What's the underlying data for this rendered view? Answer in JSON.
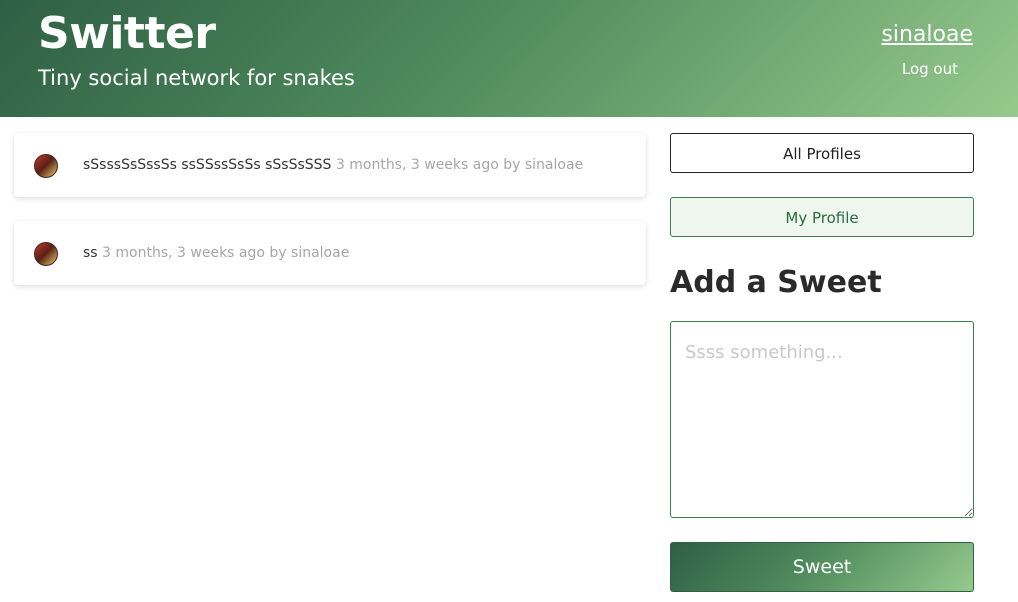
{
  "header": {
    "title": "Switter",
    "subtitle": "Tiny social network for snakes",
    "username": "sinaloae",
    "logout_label": "Log out"
  },
  "feed": {
    "sweets": [
      {
        "text": "sSsssSsSssSs ssSSssSsSs sSsSsSSS",
        "meta": "3 months, 3 weeks ago by sinaloae"
      },
      {
        "text": "ss",
        "meta": "3 months, 3 weeks ago by sinaloae"
      }
    ]
  },
  "sidebar": {
    "all_profiles_label": "All Profiles",
    "my_profile_label": "My Profile",
    "add_heading": "Add a Sweet",
    "textarea_placeholder": "Ssss something...",
    "textarea_value": "",
    "submit_label": "Sweet"
  },
  "colors": {
    "brand_dark": "#2f5f45",
    "brand_light": "#96c98c",
    "accent_green": "#3e7d52",
    "meta_gray": "#a6a6a6"
  }
}
